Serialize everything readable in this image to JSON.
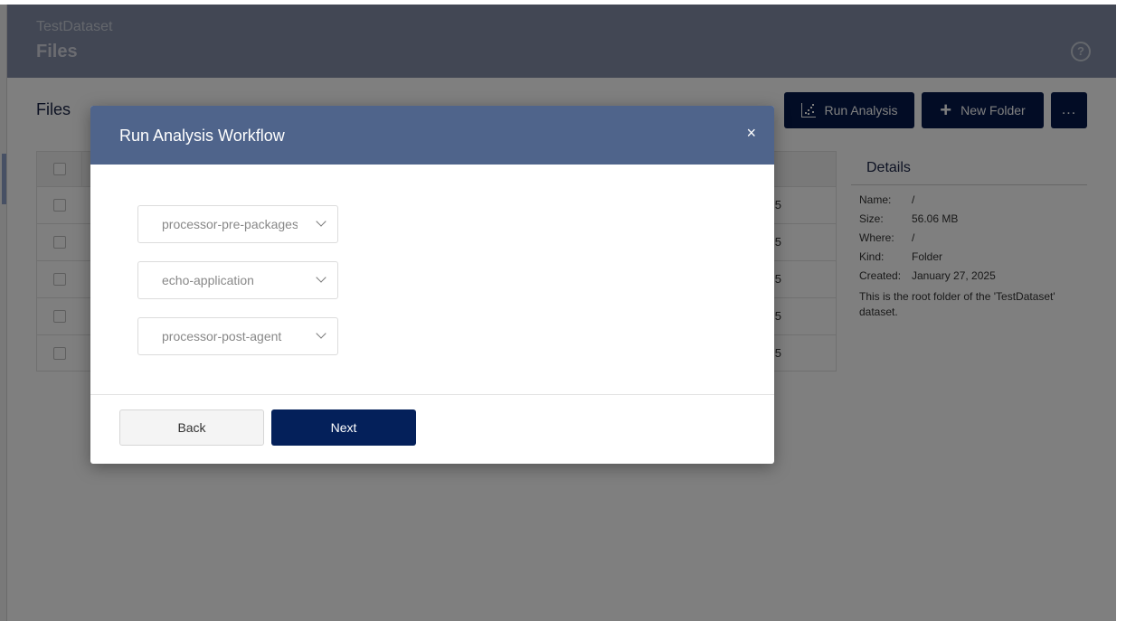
{
  "header": {
    "breadcrumb": "TestDataset",
    "title": "Files",
    "help_icon": "question-circle-icon"
  },
  "content": {
    "title": "Files",
    "toolbar": {
      "run_analysis_label": "Run Analysis",
      "run_analysis_icon": "chart-scatter-icon",
      "new_folder_label": "New Folder",
      "new_folder_icon": "plus-icon",
      "more_label": "..."
    },
    "table": {
      "rows": [
        {
          "date_suffix": "5"
        },
        {
          "date_suffix": "5"
        },
        {
          "date_suffix": "5"
        },
        {
          "date_suffix": "5"
        },
        {
          "date_suffix": "5"
        }
      ]
    }
  },
  "details": {
    "title": "Details",
    "fields": [
      {
        "label": "Name:",
        "value": "/"
      },
      {
        "label": "Size:",
        "value": "56.06 MB"
      },
      {
        "label": "Where:",
        "value": "/"
      },
      {
        "label": "Kind:",
        "value": "Folder"
      },
      {
        "label": "Created:",
        "value": "January 27, 2025"
      }
    ],
    "description": "This is the root folder of the 'TestDataset' dataset."
  },
  "modal": {
    "title": "Run Analysis Workflow",
    "close_label": "×",
    "selects": [
      {
        "value": "processor-pre-packages"
      },
      {
        "value": "echo-application"
      },
      {
        "value": "processor-post-agent"
      }
    ],
    "back_label": "Back",
    "next_label": "Next"
  }
}
